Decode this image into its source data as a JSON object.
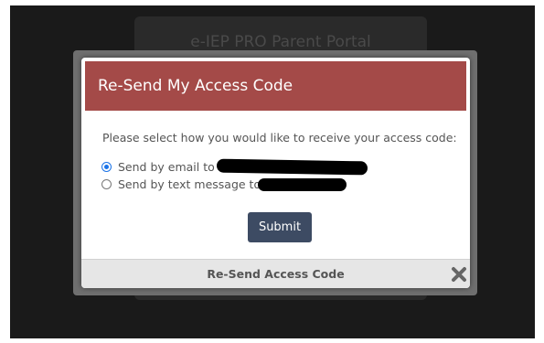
{
  "background": {
    "title": "e-IEP PRO Parent Portal"
  },
  "modal": {
    "title": "Re-Send My Access Code",
    "prompt": "Please select how you would like to receive your access code:",
    "options": [
      {
        "label": "Send by email to",
        "selected": true
      },
      {
        "label": "Send by text message to",
        "selected": false
      }
    ],
    "submit_label": "Submit",
    "footer_label": "Re-Send Access Code",
    "close_icon": "close-icon"
  },
  "colors": {
    "header": "#a44a48",
    "submit": "#3d4b63",
    "radio_selected": "#1a73e8"
  }
}
